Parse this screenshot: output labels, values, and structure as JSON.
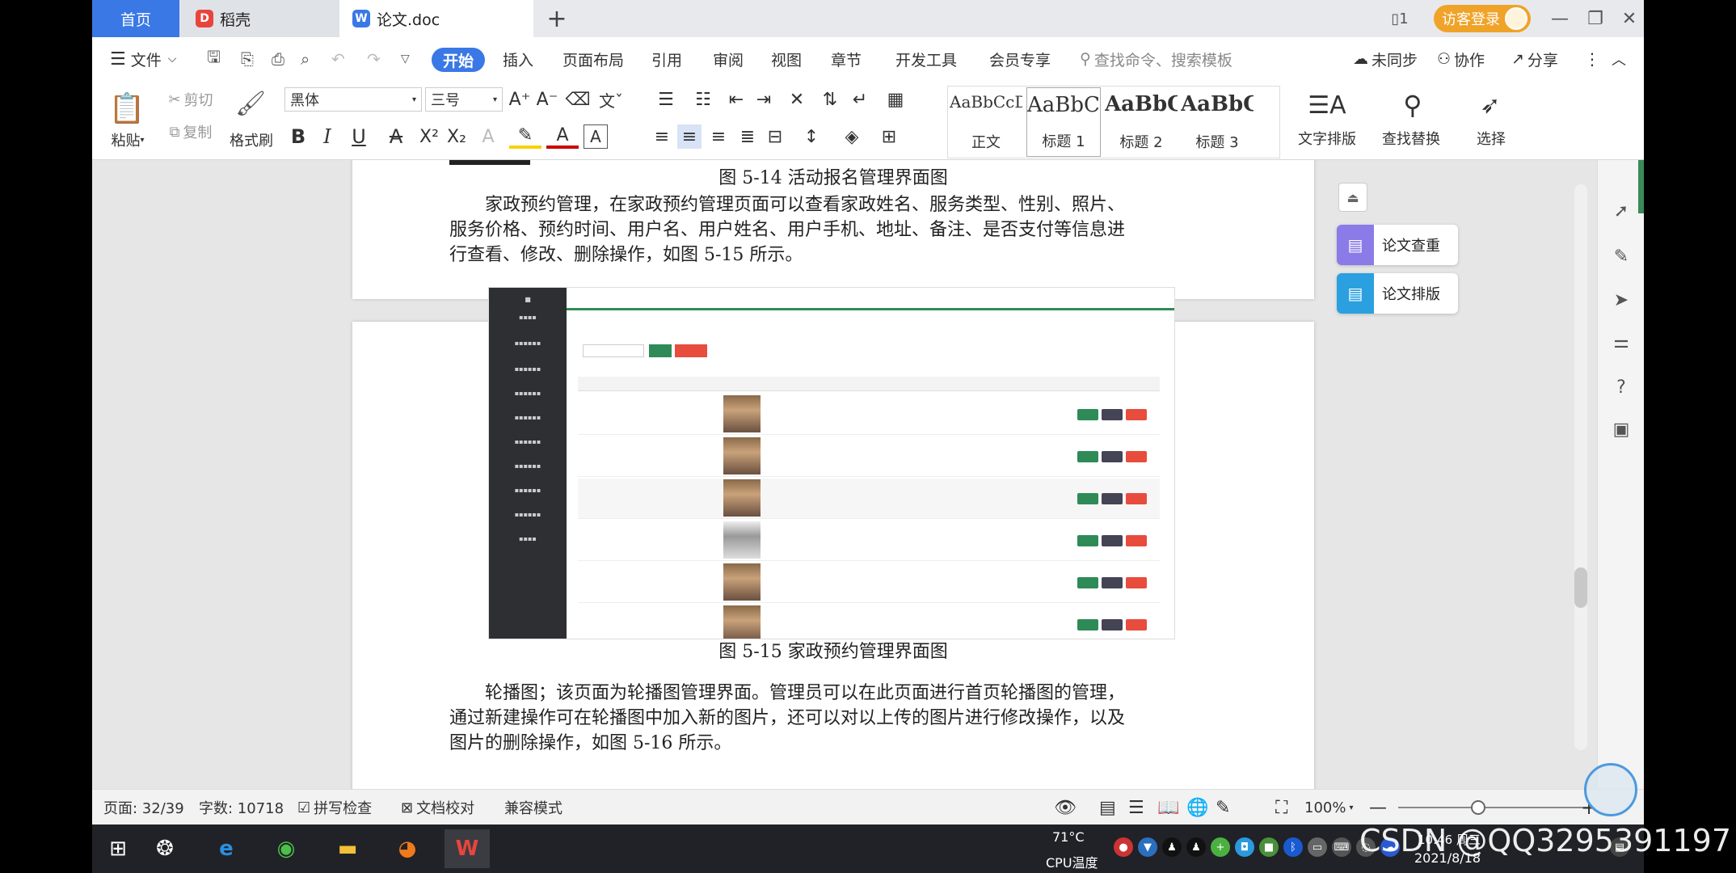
{
  "tabs": {
    "home": "首页",
    "daoke": "稻壳",
    "doc": "论文.doc",
    "add": "+"
  },
  "login": "访客登录",
  "menu": {
    "file": "文件",
    "start": "开始",
    "items": [
      "插入",
      "页面布局",
      "引用",
      "审阅",
      "视图",
      "章节",
      "开发工具",
      "会员专享"
    ],
    "search_placeholder": "查找命令、搜索模板",
    "unsync": "未同步",
    "collab": "协作",
    "share": "分享"
  },
  "ribbon": {
    "paste": "粘贴",
    "cut": "剪切",
    "copy": "复制",
    "format_painter": "格式刷",
    "font": "黑体",
    "size": "三号",
    "styles": [
      {
        "preview": "AaBbCcDd",
        "name": "正文"
      },
      {
        "preview": "AaBbC",
        "name": "标题 1"
      },
      {
        "preview": "AaBbC",
        "name": "标题 2"
      },
      {
        "preview": "AaBbC",
        "name": "标题 3"
      }
    ],
    "text_layout": "文字排版",
    "find_replace": "查找替换",
    "select": "选择"
  },
  "doc": {
    "caption1": "图 5-14 活动报名管理界面图",
    "para1": "家政预约管理，在家政预约管理页面可以查看家政姓名、服务类型、性别、照片、服务价格、预约时间、用户名、用户姓名、用户手机、地址、备注、是否支付等信息进行查看、修改、删除操作，如图 5-15 所示。",
    "caption2": "图 5-15 家政预约管理界面图",
    "para2": "轮播图；该页面为轮播图管理界面。管理员可以在此页面进行首页轮播图的管理，通过新建操作可在轮播图中加入新的图片，还可以对以上传的图片进行修改操作，以及图片的删除操作，如图 5-16 所示。"
  },
  "side": {
    "check": "论文查重",
    "layout": "论文排版"
  },
  "status": {
    "page": "页面: 32/39",
    "words": "字数: 10718",
    "spell": "拼写检查",
    "proof": "文档校对",
    "compat": "兼容模式",
    "zoom": "100%"
  },
  "taskbar": {
    "temp": "71°C",
    "cpu": "CPU温度",
    "date": "2021/8/18",
    "time": "10:46 周三"
  },
  "watermark": "CSDN @QQ3295391197"
}
